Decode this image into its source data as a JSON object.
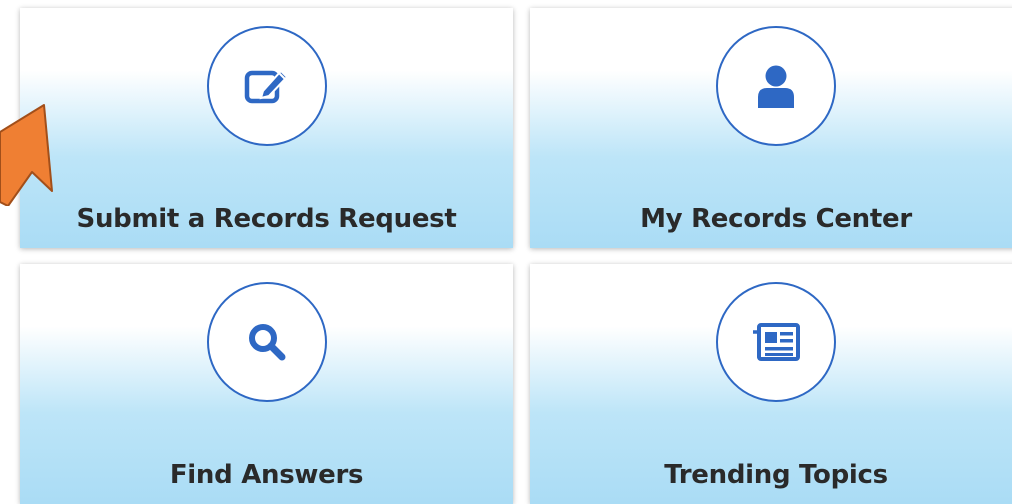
{
  "tiles": [
    {
      "label": "Submit a Records Request",
      "icon": "edit-icon"
    },
    {
      "label": "My Records Center",
      "icon": "user-icon"
    },
    {
      "label": "Find Answers",
      "icon": "search-icon"
    },
    {
      "label": "Trending Topics",
      "icon": "newspaper-icon"
    }
  ],
  "colors": {
    "accent": "#2e68c4",
    "tile_gradient_bottom": "#aadcf5",
    "label_text": "#2a2a2a",
    "callout_arrow": "#ef7f33"
  },
  "annotation": {
    "icon": "callout-arrow",
    "points_to": "Submit a Records Request"
  }
}
